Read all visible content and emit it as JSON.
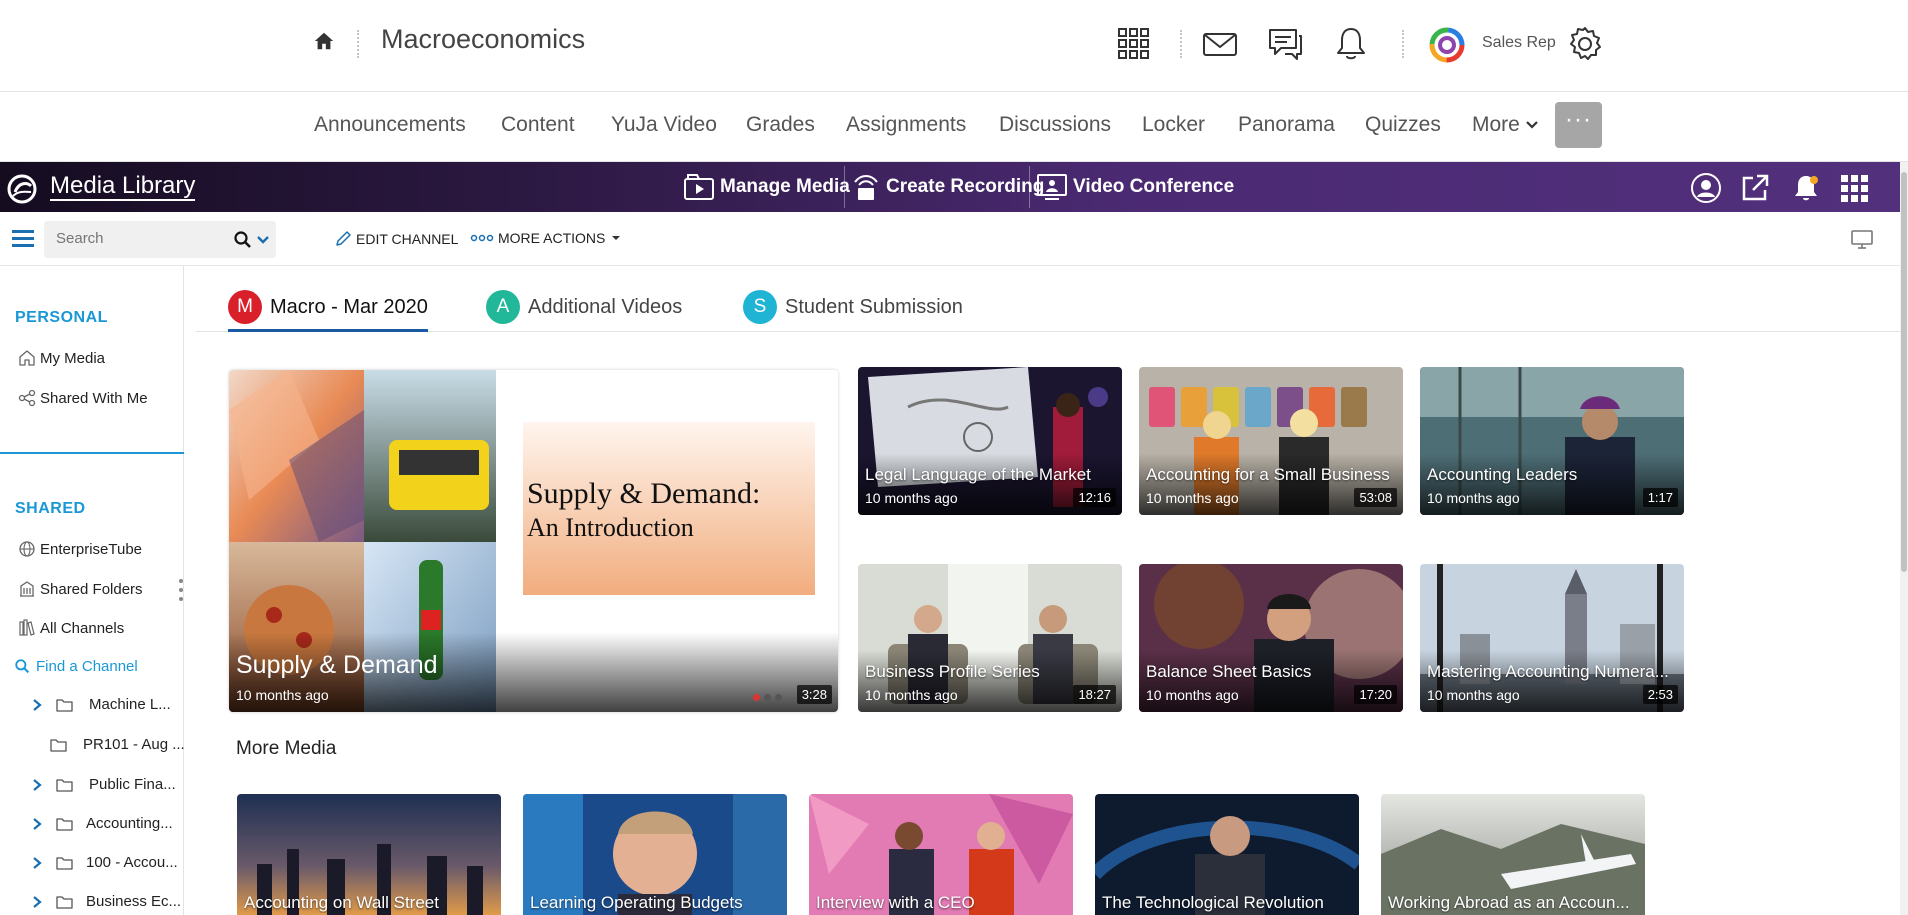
{
  "header": {
    "course_title": "Macroeconomics",
    "user_name": "Sales Rep"
  },
  "nav": {
    "items": [
      "Announcements",
      "Content",
      "YuJa Video",
      "Grades",
      "Assignments",
      "Discussions",
      "Locker",
      "Panorama",
      "Quizzes"
    ],
    "more_label": "More",
    "overflow_label": "···"
  },
  "yuja": {
    "title": "Media Library",
    "manage_media": "Manage Media",
    "create_recording": "Create Recording",
    "video_conference": "Video Conference"
  },
  "toolbar": {
    "search_placeholder": "Search",
    "edit_channel": "EDIT CHANNEL",
    "more_actions": "MORE ACTIONS"
  },
  "sidebar": {
    "personal_heading": "PERSONAL",
    "my_media": "My Media",
    "shared_with_me": "Shared With Me",
    "shared_heading": "SHARED",
    "enterprise_tube": "EnterpriseTube",
    "shared_folders": "Shared Folders",
    "all_channels": "All Channels",
    "find_channel": "Find a Channel",
    "tree": [
      {
        "label": "Machine L...",
        "expandable": true
      },
      {
        "label": "PR101 - Aug ...",
        "expandable": false
      },
      {
        "label": "Public Fina...",
        "expandable": true
      },
      {
        "label": "Accounting...",
        "expandable": true
      },
      {
        "label": "100 - Accou...",
        "expandable": true
      },
      {
        "label": "Business Ec...",
        "expandable": true
      }
    ]
  },
  "tabs": [
    {
      "badge": "M",
      "label": "Macro - Mar 2020",
      "color": "#d9202a",
      "active": true
    },
    {
      "badge": "A",
      "label": "Additional Videos",
      "color": "#21b89a",
      "active": false
    },
    {
      "badge": "S",
      "label": "Student Submission",
      "color": "#1fb3d4",
      "active": false
    }
  ],
  "featured": {
    "title": "Supply & Demand",
    "age": "10 months ago",
    "duration": "3:28",
    "slide_line1": "Supply & Demand:",
    "slide_line2": "An Introduction"
  },
  "cards": [
    {
      "title": "Legal Language of the Market",
      "age": "10 months ago",
      "duration": "12:16"
    },
    {
      "title": "Accounting for a Small Business",
      "age": "10 months ago",
      "duration": "53:08"
    },
    {
      "title": "Accounting Leaders",
      "age": "10 months ago",
      "duration": "1:17"
    },
    {
      "title": "Business Profile Series",
      "age": "10 months ago",
      "duration": "18:27"
    },
    {
      "title": "Balance Sheet Basics",
      "age": "10 months ago",
      "duration": "17:20"
    },
    {
      "title": "Mastering Accounting Numera...",
      "age": "10 months ago",
      "duration": "2:53"
    }
  ],
  "more_media": {
    "heading": "More Media",
    "items": [
      {
        "title": "Accounting on Wall Street"
      },
      {
        "title": "Learning Operating Budgets"
      },
      {
        "title": "Interview with a CEO"
      },
      {
        "title": "The Technological Revolution"
      },
      {
        "title": "Working Abroad as an Accoun..."
      }
    ]
  },
  "colors": {
    "accent_blue": "#1a98d5",
    "yuja_purple": "#52307c",
    "active_tab_underline": "#1a5aa0"
  }
}
